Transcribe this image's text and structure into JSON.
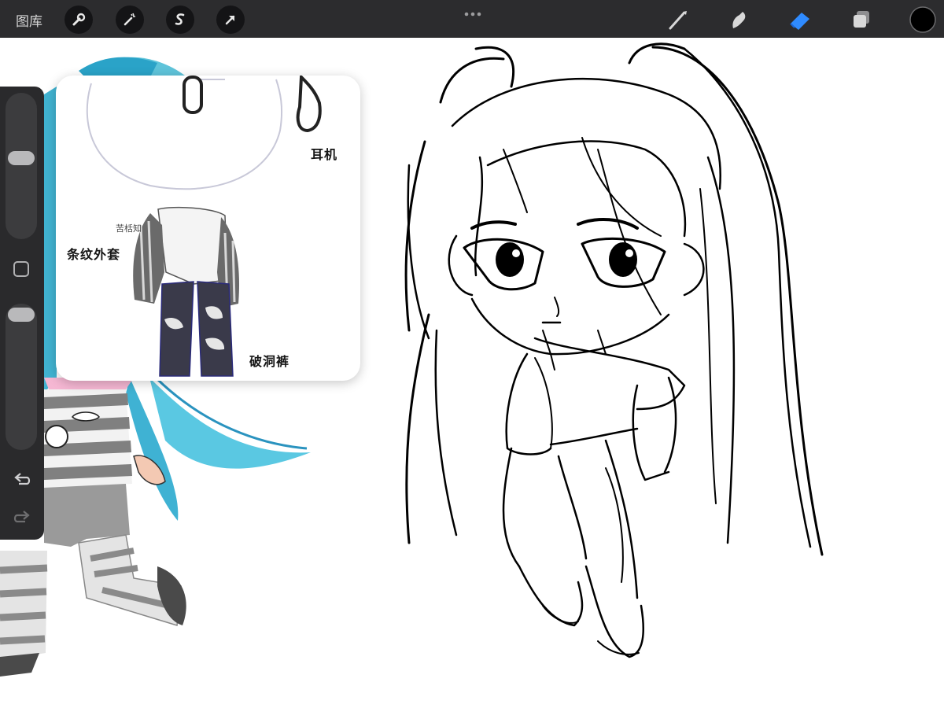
{
  "topbar": {
    "gallery_label": "图库",
    "left_tools": [
      "wrench-icon",
      "magic-wand-icon",
      "selection-icon",
      "transform-arrow-icon"
    ],
    "right_tools": [
      "brush-icon",
      "smudge-icon",
      "eraser-icon",
      "layers-icon",
      "color-swatch"
    ],
    "active_tool": "eraser",
    "active_color": "#000000",
    "accent_color": "#2f8bff"
  },
  "sidebar": {
    "brush_size_level": 0.55,
    "opacity_level": 0.95,
    "buttons": [
      "modify-button",
      "undo-icon",
      "redo-icon"
    ]
  },
  "reference_window": {
    "labels": {
      "headphones": "耳机",
      "striped_jacket": "条纹外套",
      "ripped_pants": "破洞裤"
    },
    "watermark": "苦栝知"
  }
}
